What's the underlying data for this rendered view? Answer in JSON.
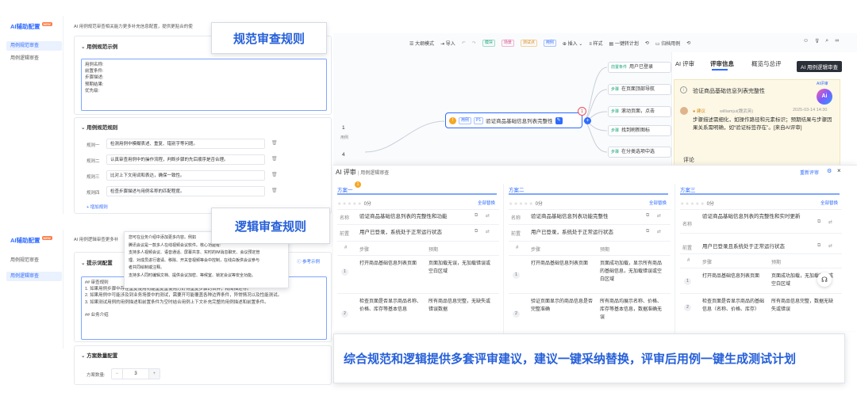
{
  "top_panel": {
    "sidebar_title": "AI辅助配置",
    "sidebar_badge": "NEW",
    "sidebar_items": [
      "用例规范审查",
      "用例逻辑审查"
    ],
    "desc": "AI 用例规范审查相关能力更多补充信息配置，提供更贴合的使",
    "callout": "规范审查规则",
    "sec_example": "用例规范示例",
    "example_lines": [
      "用例名称:",
      "前置条件:",
      "步骤描述:",
      "预期结果:",
      "优先级:"
    ],
    "sec_rules": "用例规范规则",
    "rules": [
      {
        "label": "规则一",
        "value": "检测用例中模糊表述、重复、错别字等问题。"
      },
      {
        "label": "规则二",
        "value": "认真审查用例中的操作流程，判断步骤的先后顺序是否合理。"
      },
      {
        "label": "规则三",
        "value": "比对上下文用词和表达，确保一致性。"
      },
      {
        "label": "规则四",
        "value": "检查步骤描述与用例名称的匹配程度。"
      }
    ],
    "add_rule": "+ 增加规则"
  },
  "bottom_panel": {
    "sidebar_title": "AI辅助配置",
    "sidebar_badge": "NEW",
    "sidebar_items": [
      "用例规范审查",
      "用例逻辑审查"
    ],
    "desc": "AI 用例逻辑审查更多补",
    "callout": "逻辑审查规则",
    "tooltip": [
      "您可在业务介绍中添加更多内容。例如",
      "腾讯会议是一款多人在线视频会议软件。核心功能有:",
      "支持多人视频会议、语音通话、屏幕共享、实时的IM消息聊天、会议预定管",
      "理、对成员进行邀请、移除、开关音视频等会中控制，在线白板供会议参与",
      "者共同绘制或注释。",
      "支持多人同时编辑文档、提供会议加密、等候室、锁定会议等安全功能。"
    ],
    "sec_prompt": "提示词配置",
    "ref_example": "参考示例",
    "prompt_lines": [
      "## 审查规则",
      "1. 如果用例步骤中存在重复使用功能重复重使用方好得重复步骤的合并，精简描述等。",
      "2. 如果用例中可能涉及到业务场景中的测试，需要开可能覆盖各种边界条件，异常情况以及性能测试。",
      "3. 如果测试用例的用例描述和前置条件为空时结合用例上下文补充完整的用例描述和前置条件。",
      "",
      "## 业务介绍"
    ],
    "sec_plan": "方案数量配置",
    "plan_label": "方案数量:",
    "plan_minus": "−",
    "plan_value": "3",
    "plan_plus": "+"
  },
  "mindmap": {
    "toolbar": [
      "大纲模式",
      "导入",
      "模块",
      "场景",
      "测试点",
      "用例",
      "插入",
      "样式",
      "一键转计划",
      "归档用例"
    ],
    "center_node": {
      "tag1": "用例",
      "tag2": "P1",
      "text": "验证商品基础信息列表完整性"
    },
    "nodes": [
      {
        "label": "前置条件",
        "text": "用户已登录"
      },
      {
        "label": "步骤",
        "text": "在页面顶部导航"
      },
      {
        "label": "步骤",
        "text": "滚动页面，点击"
      },
      {
        "label": "步骤",
        "text": "找到刷新图标"
      },
      {
        "label": "步骤",
        "text": "在分类选项中选"
      }
    ],
    "left_nums": [
      "1",
      "4"
    ],
    "left_sub": "用例",
    "badge_count": "1"
  },
  "review_panel": {
    "tabs": [
      "AI 评审",
      "评审信息",
      "概览与总评"
    ],
    "tooltip": "AI 用例逻辑审查",
    "ai_label": "AI评审",
    "title": "验证商品基础信息列表完整性",
    "user": "williamjui(魏武英)",
    "time": "2025-03-14 14:30",
    "advice_tag": "建议",
    "advice": "步骤描述需细化，如操作路径和元素标识；预期结果与步骤因果关系需明确，如“验证标签存在”。[来自AI评审]",
    "comment": "评论"
  },
  "ai_review": {
    "title": "AI 评审",
    "subtitle": "用例逻辑审查",
    "rereview": "重新评审",
    "plans": [
      {
        "tag": "方案一",
        "score": "0分",
        "replace": "全部替换",
        "name_label": "名称",
        "name": "验证商品基础信息列表的完整性和功能",
        "pre_label": "前置",
        "pre": "用户已登录，系统处于正常运行状态",
        "col_num": "#",
        "col_step": "步骤",
        "col_exp": "预期",
        "steps": [
          {
            "n": "1",
            "step": "打开商品基础信息列表页面",
            "exp": "页面加载无误，无加载错误或空白区域"
          },
          {
            "n": "2",
            "step": "检查页面是否显示商品名称、价格、库存等基本信息",
            "exp": "所有商品信息完整，无缺失或错误数据"
          }
        ]
      },
      {
        "tag": "方案二",
        "score": "0分",
        "replace": "全部替换",
        "name_label": "名称",
        "name": "验证商品基础信息列表功能完整性",
        "pre_label": "前置",
        "pre": "用户已登录，系统处于正常运行状态",
        "col_num": "#",
        "col_step": "步骤",
        "col_exp": "预期",
        "steps": [
          {
            "n": "1",
            "step": "打开商品基础信息列表页面",
            "exp": "页面成功加载，显示所有商品的基础信息，无加载错误或空白区域"
          },
          {
            "n": "2",
            "step": "验证页面显示的商品信息是否完整准确",
            "exp": "所有商品均展示名称、价格、库存等基本信息，数据准确无误"
          }
        ]
      },
      {
        "tag": "方案三",
        "score": "0分",
        "replace": "全部替换",
        "name_label": "名称",
        "name": "验证商品基础信息列表的完整性和实时更新",
        "pre_label": "前置",
        "pre": "用户已登录且系统处于正常运行状态",
        "col_num": "#",
        "col_step": "步骤",
        "col_exp": "预期",
        "steps": [
          {
            "n": "1",
            "step": "打开商品基础信息列表页面",
            "exp": "页面成功加载，无加载错误或空白区域"
          },
          {
            "n": "2",
            "step": "检查页面是否显示商品的基础信息（名称、价格、库存）",
            "exp": "所有商品信息完整，数据无缺失或错误"
          }
        ]
      }
    ]
  },
  "banner": "综合规范和逻辑提供多套评审建议，建议一键采纳替换，评审后用例一键生成测试计划"
}
